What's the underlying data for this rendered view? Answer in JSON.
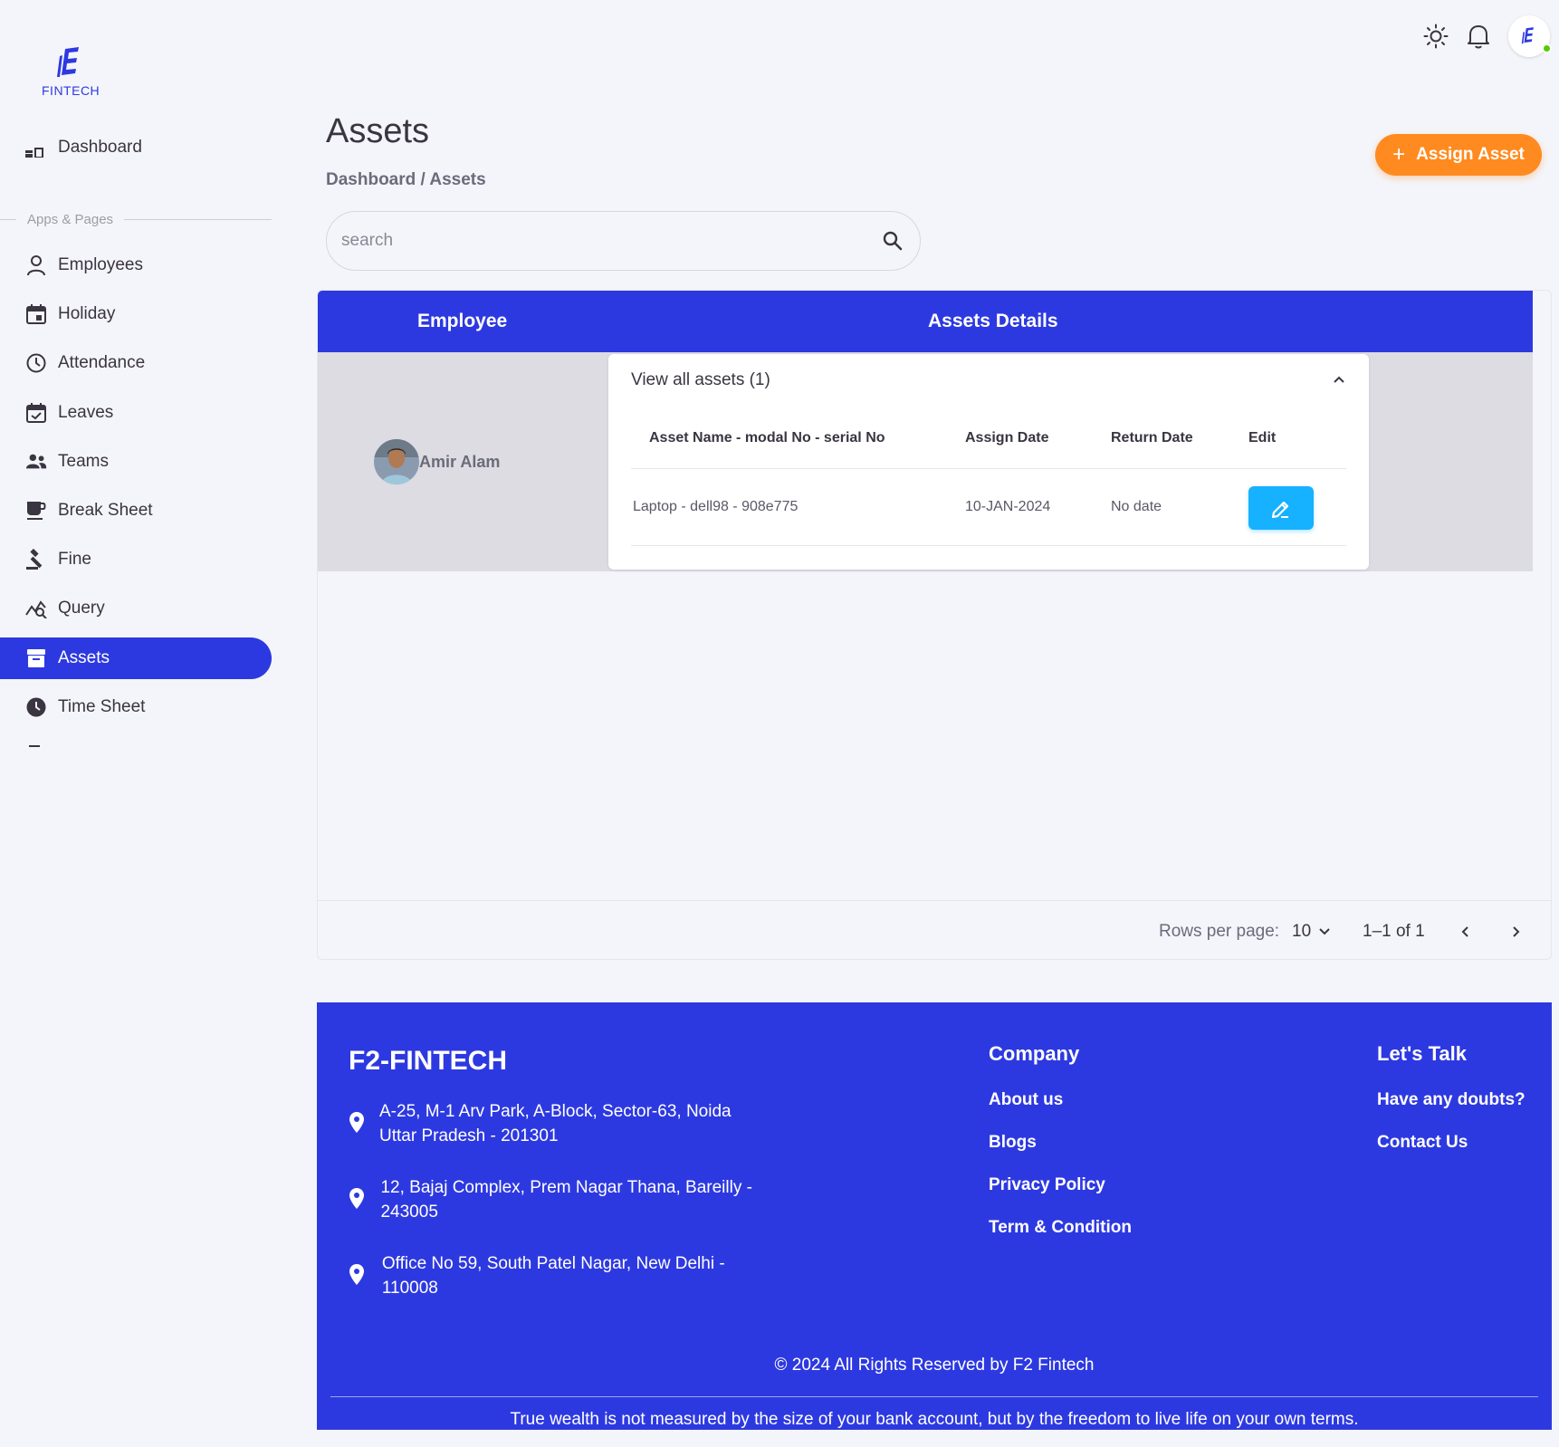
{
  "brand": {
    "logo_text": "FINTECH"
  },
  "sidebar": {
    "dashboard_label": "Dashboard",
    "section_label": "Apps & Pages",
    "items": [
      {
        "label": "Employees",
        "icon": "person-icon"
      },
      {
        "label": "Holiday",
        "icon": "calendar-icon"
      },
      {
        "label": "Attendance",
        "icon": "clock-icon"
      },
      {
        "label": "Leaves",
        "icon": "calendar-check-icon"
      },
      {
        "label": "Teams",
        "icon": "group-icon"
      },
      {
        "label": "Break Sheet",
        "icon": "coffee-icon"
      },
      {
        "label": "Fine",
        "icon": "gavel-icon"
      },
      {
        "label": "Query",
        "icon": "query-stats-icon"
      },
      {
        "label": "Assets",
        "icon": "archive-icon",
        "active": true
      },
      {
        "label": "Time Sheet",
        "icon": "clock-filled-icon"
      }
    ]
  },
  "topbar": {
    "icons": [
      "sun-icon",
      "bell-icon",
      "user-avatar"
    ]
  },
  "header": {
    "title": "Assets",
    "breadcrumb": "Dashboard / Assets",
    "assign_button": "Assign Asset"
  },
  "search": {
    "placeholder": "search",
    "value": ""
  },
  "table": {
    "columns": [
      "Employee",
      "Assets Details"
    ],
    "rows": [
      {
        "employee": "Amir Alam",
        "accordion_title": "View all assets (1)",
        "inner_columns": [
          "Asset Name - modal No - serial No",
          "Assign Date",
          "Return Date",
          "Edit"
        ],
        "assets": [
          {
            "name": "Laptop - dell98 - 908e775",
            "assign_date": "10-JAN-2024",
            "return_date": "No date"
          }
        ]
      }
    ]
  },
  "pagination": {
    "rows_label": "Rows per page:",
    "rows_value": "10",
    "range": "1–1 of 1"
  },
  "footer": {
    "brand": "F2-FINTECH",
    "addresses": [
      "A-25, M-1 Arv Park, A-Block, Sector-63, Noida Uttar Pradesh - 201301",
      "12, Bajaj Complex, Prem Nagar Thana, Bareilly - 243005",
      "Office No 59, South Patel Nagar, New Delhi - 110008"
    ],
    "company_title": "Company",
    "company_links": [
      "About us",
      "Blogs",
      "Privacy Policy",
      "Term & Condition"
    ],
    "talk_title": "Let's Talk",
    "talk_links": [
      "Have any doubts?",
      "Contact Us"
    ],
    "copyright": "© 2024 All Rights Reserved by F2 Fintech",
    "quote": "True wealth is not measured by the size of your bank account, but by the freedom to live life on your own terms."
  },
  "colors": {
    "primary": "#2d39e0",
    "accent": "#ff8a1f",
    "info": "#16b1ff",
    "online": "#56ca00"
  }
}
